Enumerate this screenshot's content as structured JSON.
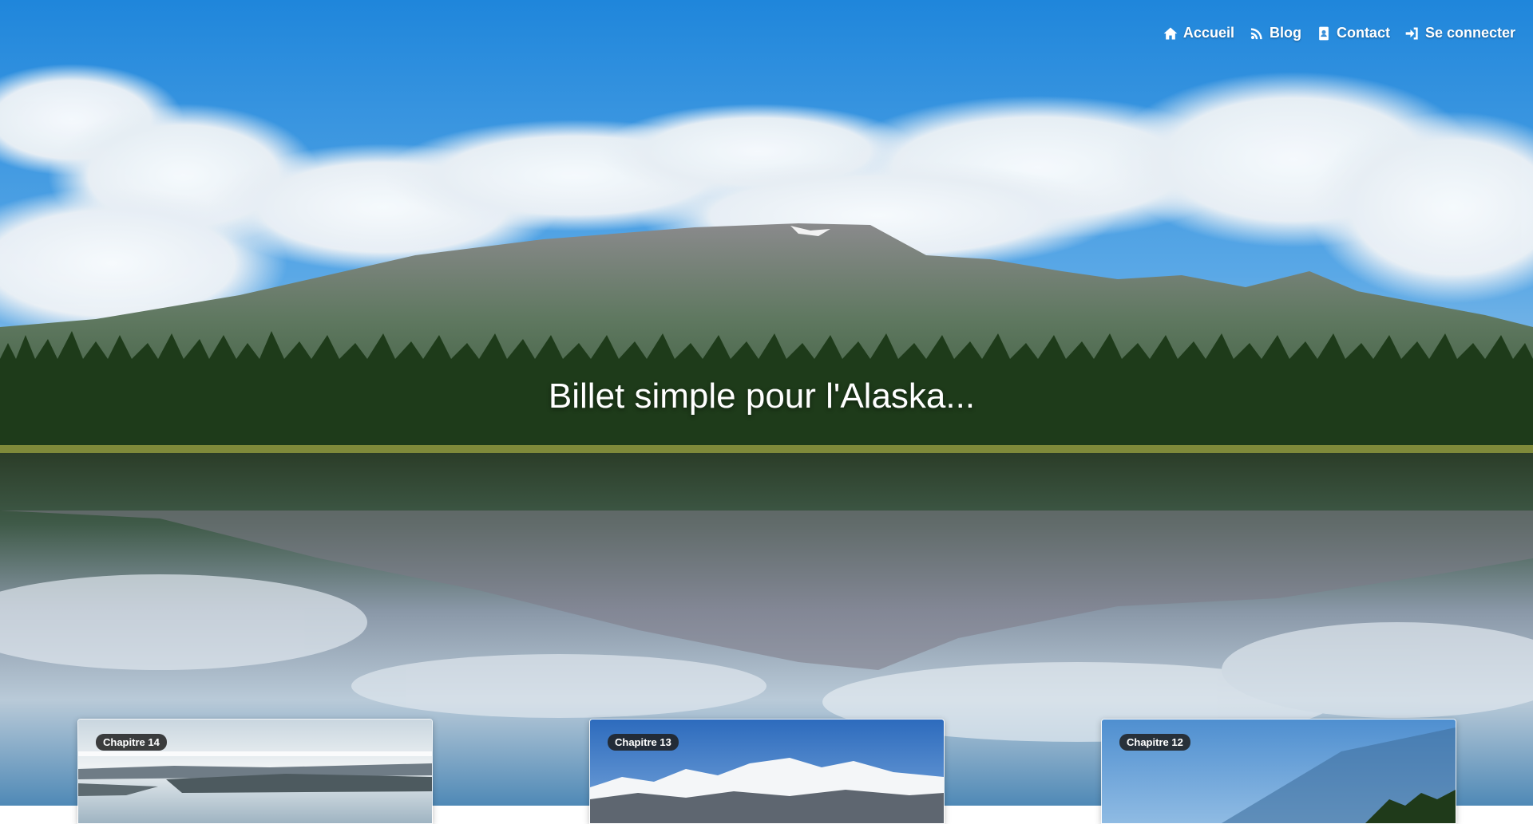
{
  "nav": {
    "items": [
      {
        "label": "Accueil",
        "icon": "home-icon"
      },
      {
        "label": "Blog",
        "icon": "rss-icon"
      },
      {
        "label": "Contact",
        "icon": "address-book-icon"
      },
      {
        "label": "Se connecter",
        "icon": "sign-in-icon"
      }
    ]
  },
  "hero": {
    "title": "Billet simple pour l'Alaska..."
  },
  "cards": [
    {
      "badge": "Chapitre 14"
    },
    {
      "badge": "Chapitre 13"
    },
    {
      "badge": "Chapitre 12"
    }
  ],
  "colors": {
    "sky": "#2f8fde",
    "water": "#5f8fb0",
    "forest": "#1f3a1a",
    "badge_bg": "#1e1e1e"
  }
}
